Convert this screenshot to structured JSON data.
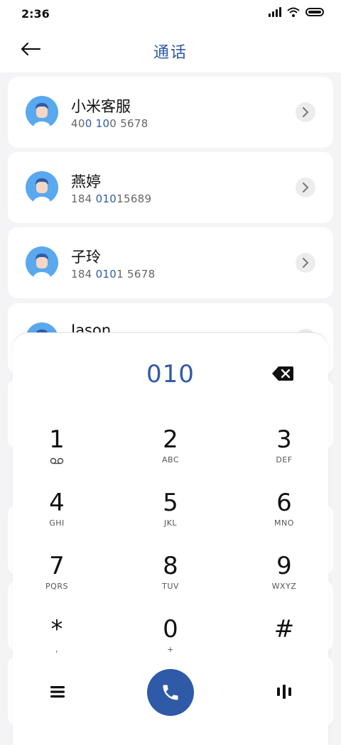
{
  "status_bar": {
    "time": "2:36"
  },
  "header": {
    "title": "通话"
  },
  "contacts": [
    {
      "name": "小米客服",
      "number_parts": [
        "40",
        "0 10",
        "0 5678"
      ]
    },
    {
      "name": "燕婷",
      "number_parts": [
        "184 ",
        "010",
        "15689"
      ]
    },
    {
      "name": "子玲",
      "number_parts": [
        "184 ",
        "010",
        "1 5678"
      ]
    },
    {
      "name": "Jason",
      "number_parts": [
        "",
        "",
        ""
      ]
    }
  ],
  "dialpad": {
    "input_value": "010",
    "keys": [
      {
        "digit": "1",
        "letters": ""
      },
      {
        "digit": "2",
        "letters": "ABC"
      },
      {
        "digit": "3",
        "letters": "DEF"
      },
      {
        "digit": "4",
        "letters": "GHI"
      },
      {
        "digit": "5",
        "letters": "JKL"
      },
      {
        "digit": "6",
        "letters": "MNO"
      },
      {
        "digit": "7",
        "letters": "PQRS"
      },
      {
        "digit": "8",
        "letters": "TUV"
      },
      {
        "digit": "9",
        "letters": "WXYZ"
      },
      {
        "digit": "*",
        "letters": ","
      },
      {
        "digit": "0",
        "letters": "+"
      },
      {
        "digit": "#",
        "letters": ""
      }
    ]
  },
  "colors": {
    "accent": "#2f5aa8",
    "avatar": "#5aa8ee",
    "background": "#f4f4f6"
  },
  "icons": {
    "back": "arrow-left-icon",
    "chevron": "chevron-right-icon",
    "backspace": "backspace-icon",
    "voicemail": "voicemail-icon",
    "menu": "menu-icon",
    "call": "phone-icon",
    "voice": "voice-bars-icon"
  }
}
